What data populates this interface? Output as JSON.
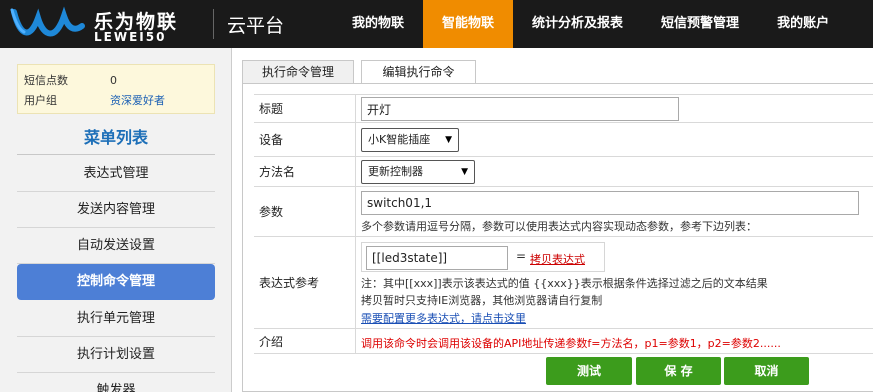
{
  "header": {
    "logo_cn": "乐为物联",
    "logo_en": "LEWEI50",
    "platform": "云平台",
    "nav": [
      {
        "label": "我的物联"
      },
      {
        "label": "智能物联"
      },
      {
        "label": "统计分析及报表"
      },
      {
        "label": "短信预警管理"
      },
      {
        "label": "我的账户"
      }
    ],
    "active_nav_index": 1,
    "accent_color": "#f08c00"
  },
  "sidebar": {
    "stats": [
      {
        "label": "短信点数",
        "value": "0"
      },
      {
        "label": "用户组",
        "value": "资深爱好者"
      }
    ],
    "menu_title": "菜单列表",
    "items": [
      {
        "label": "表达式管理"
      },
      {
        "label": "发送内容管理"
      },
      {
        "label": "自动发送设置"
      },
      {
        "label": "控制命令管理"
      },
      {
        "label": "执行单元管理"
      },
      {
        "label": "执行计划设置"
      },
      {
        "label": "触发器"
      }
    ],
    "active_index": 3,
    "active_color": "#4d7fd6"
  },
  "tabs": [
    {
      "label": "执行命令管理"
    },
    {
      "label": "编辑执行命令"
    }
  ],
  "form": {
    "title_label": "标题",
    "title_value": "开灯",
    "device_label": "设备",
    "device_value": "小K智能插座",
    "method_label": "方法名",
    "method_value": "更新控制器",
    "params_label": "参数",
    "params_value": "switch01,1",
    "params_hint": "多个参数请用逗号分隔，参数可以使用表达式内容实现动态参数，参考下边列表：",
    "expr_label": "表达式参考",
    "expr_value": "[[led3state]]",
    "expr_eq": "=",
    "copy_link": "拷贝表达式",
    "note1": "注：其中[[xxx]]表示该表达式的值 {{xxx}}表示根据条件选择过滤之后的文本结果",
    "note2": "拷贝暂时只支持IE浏览器，其他浏览器请自行复制",
    "note3": "需要配置更多表达式，请点击这里",
    "intro_label": "介绍",
    "intro_text": "调用该命令时会调用该设备的API地址传递参数f=方法名，p1=参数1，p2=参数2......"
  },
  "buttons": {
    "test": "测试",
    "save": "保 存",
    "cancel": "取消",
    "color": "#3c9c1c"
  }
}
